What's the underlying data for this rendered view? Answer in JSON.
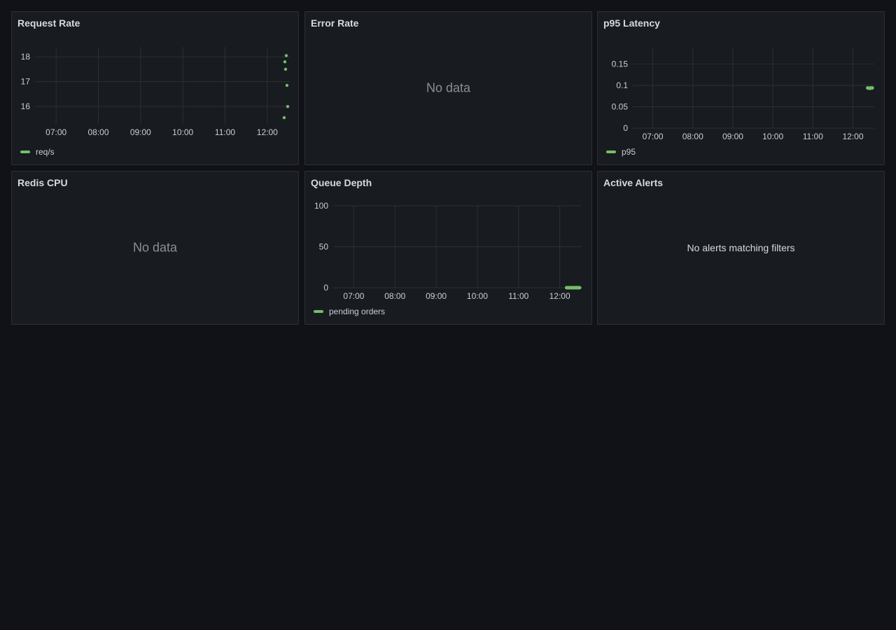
{
  "colors": {
    "series": "#73bf69",
    "grid": "#2c2f36",
    "background": "#111217",
    "panel": "#181b1f"
  },
  "panels": {
    "request_rate": {
      "title": "Request Rate",
      "legend": "req/s"
    },
    "error_rate": {
      "title": "Error Rate",
      "empty": "No data"
    },
    "p95_latency": {
      "title": "p95 Latency",
      "legend": "p95"
    },
    "redis_cpu": {
      "title": "Redis CPU",
      "empty": "No data"
    },
    "queue_depth": {
      "title": "Queue Depth",
      "legend": "pending orders"
    },
    "active_alerts": {
      "title": "Active Alerts",
      "empty": "No alerts matching filters"
    }
  },
  "chart_data": [
    {
      "id": "request_rate",
      "type": "scatter",
      "title": "Request Rate",
      "x_ticks": [
        "07:00",
        "08:00",
        "09:00",
        "10:00",
        "11:00",
        "12:00"
      ],
      "xlim": [
        "06:30",
        "12:32"
      ],
      "y_ticks": [
        "16",
        "17",
        "18"
      ],
      "ylim": [
        15.3,
        18.4
      ],
      "grid": true,
      "legend_position": "bottom-left",
      "series": [
        {
          "name": "req/s",
          "points": [
            [
              "12:25",
              17.8
            ],
            [
              "12:26",
              17.5
            ],
            [
              "12:27",
              18.05
            ],
            [
              "12:28",
              16.85
            ],
            [
              "12:29",
              16.0
            ],
            [
              "12:24",
              15.55
            ]
          ]
        }
      ]
    },
    {
      "id": "p95_latency",
      "type": "line",
      "title": "p95 Latency",
      "x_ticks": [
        "07:00",
        "08:00",
        "09:00",
        "10:00",
        "11:00",
        "12:00"
      ],
      "xlim": [
        "06:30",
        "12:32"
      ],
      "y_ticks": [
        "0",
        "0.05",
        "0.1",
        "0.15"
      ],
      "ylim": [
        0,
        0.19
      ],
      "grid": true,
      "legend_position": "bottom-left",
      "series": [
        {
          "name": "p95",
          "points": [
            [
              "12:22",
              0.094
            ],
            [
              "12:25",
              0.093
            ],
            [
              "12:27",
              0.094
            ],
            [
              "12:29",
              0.094
            ]
          ]
        }
      ]
    },
    {
      "id": "queue_depth",
      "type": "line",
      "title": "Queue Depth",
      "x_ticks": [
        "07:00",
        "08:00",
        "09:00",
        "10:00",
        "11:00",
        "12:00"
      ],
      "xlim": [
        "06:30",
        "12:32"
      ],
      "y_ticks": [
        "0",
        "50",
        "100"
      ],
      "ylim": [
        0,
        100
      ],
      "grid": true,
      "legend_position": "bottom-left",
      "series": [
        {
          "name": "pending orders",
          "points": [
            [
              "12:10",
              0
            ],
            [
              "12:15",
              0
            ],
            [
              "12:20",
              0
            ],
            [
              "12:25",
              0
            ],
            [
              "12:29",
              0
            ]
          ]
        }
      ]
    }
  ]
}
